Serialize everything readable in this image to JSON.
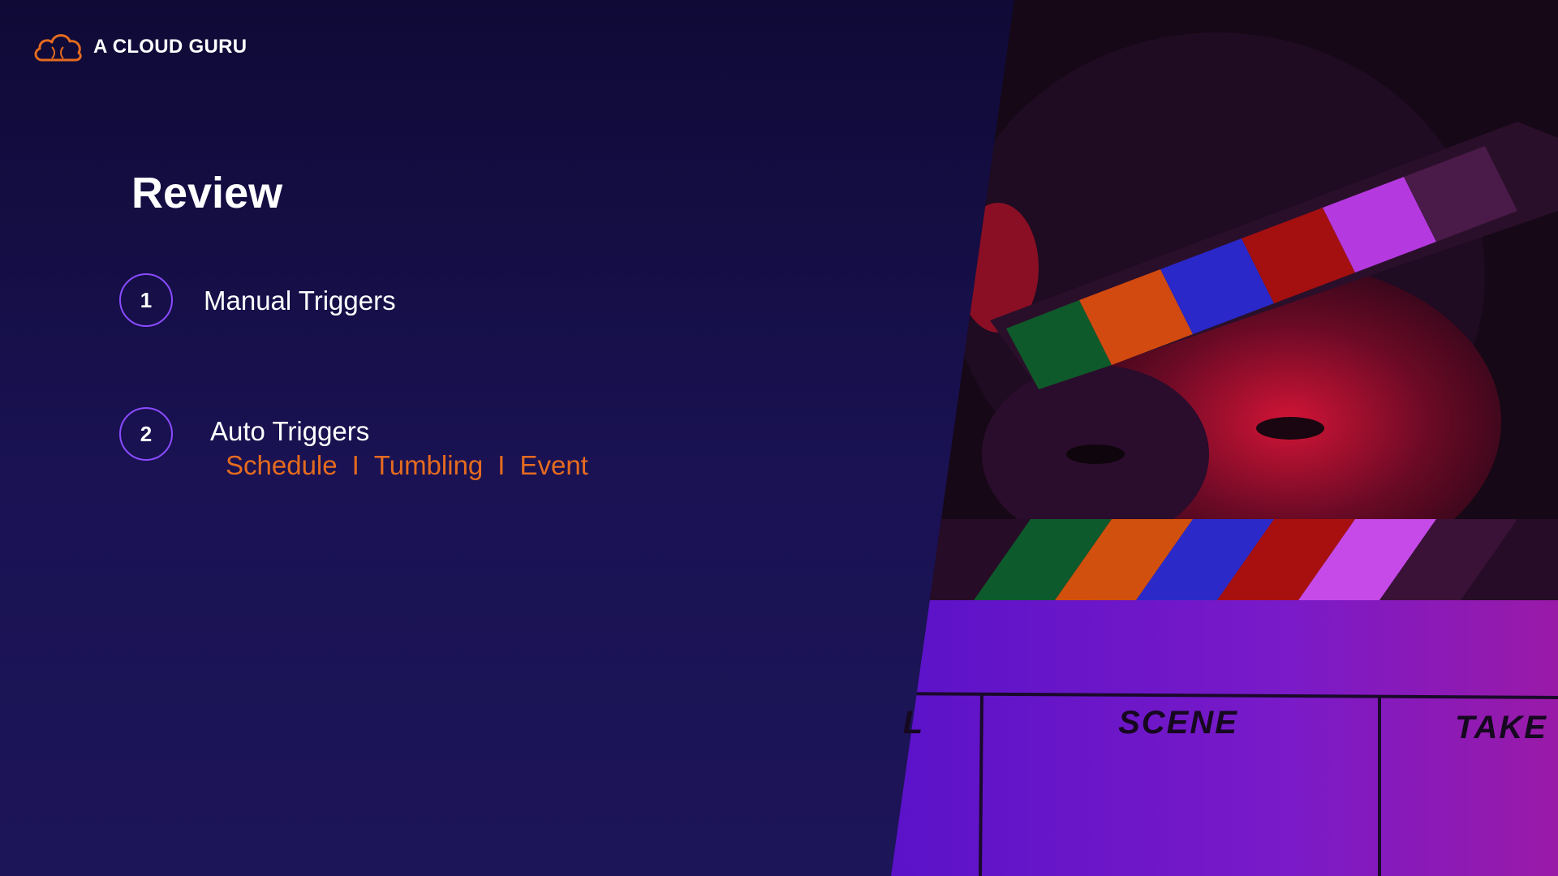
{
  "brand": {
    "name": "A CLOUD GURU",
    "logo_icon": "cloud-logo-icon",
    "logo_color": "#e56b1f"
  },
  "slide": {
    "title": "Review",
    "items": [
      {
        "number": "1",
        "label": "Manual Triggers"
      },
      {
        "number": "2",
        "label": "Auto Triggers"
      }
    ],
    "sub_items": [
      "Schedule",
      "Tumbling",
      "Event"
    ],
    "separator": "I",
    "accent_color": "#e56b1f",
    "circle_color": "#8a4bff"
  },
  "image": {
    "clapperboard_scene": "SCENE",
    "clapperboard_take": "TAKE",
    "clapperboard_left_fragment": "L"
  }
}
